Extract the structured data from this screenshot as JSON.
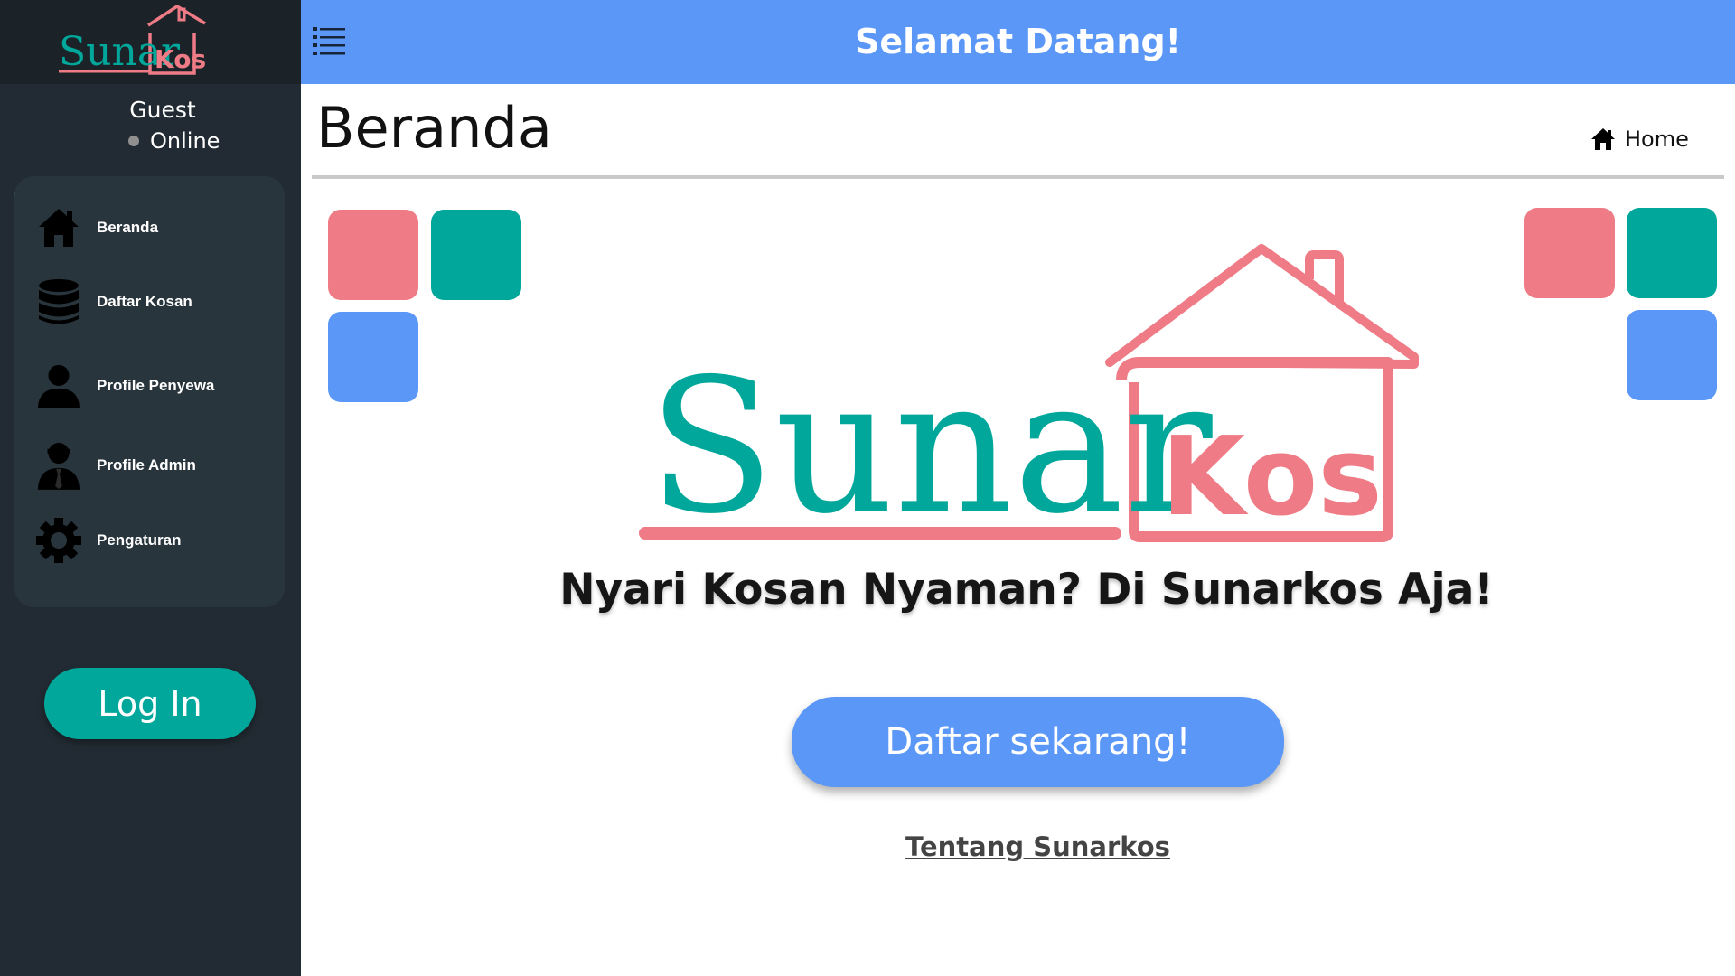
{
  "app": {
    "logo_word": "Sunar",
    "logo_badge": "Kos",
    "brand_colors": {
      "teal": "#00a79a",
      "pink": "#ee7b85",
      "blue": "#5b97f7",
      "sidebar": "#222b33"
    }
  },
  "header": {
    "title": "Selamat Datang!",
    "menu_icon": "list-icon"
  },
  "sidebar": {
    "user_name": "Guest",
    "user_status": "Online",
    "items": [
      {
        "label": "Beranda",
        "icon": "home-icon",
        "active": true
      },
      {
        "label": "Daftar Kosan",
        "icon": "database-icon",
        "active": false
      },
      {
        "label": "Profile Penyewa",
        "icon": "user-icon",
        "active": false
      },
      {
        "label": "Profile Admin",
        "icon": "admin-icon",
        "active": false
      },
      {
        "label": "Pengaturan",
        "icon": "gear-icon",
        "active": false
      }
    ],
    "login_label": "Log In"
  },
  "main": {
    "page_title": "Beranda",
    "breadcrumb": "Home",
    "tagline": "Nyari Kosan Nyaman? Di Sunarkos Aja!",
    "register_label": "Daftar sekarang!",
    "about_link": "Tentang Sunarkos"
  }
}
